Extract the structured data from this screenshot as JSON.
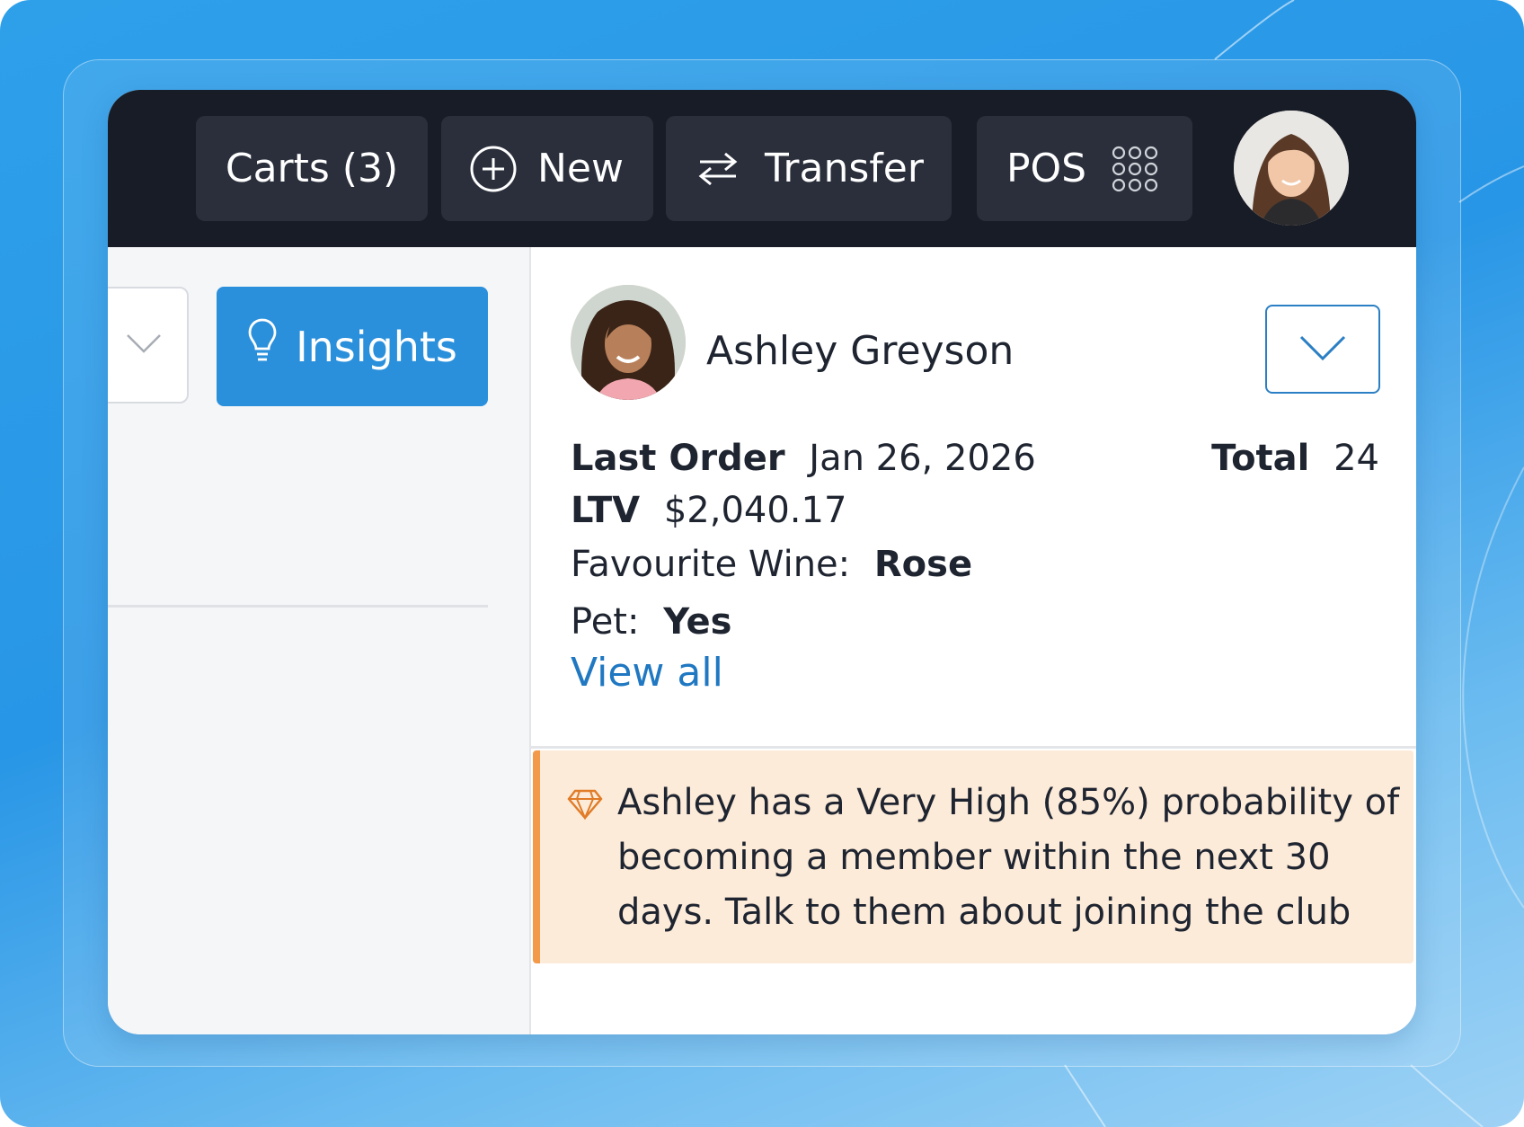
{
  "topbar": {
    "carts_label": "Carts (3)",
    "new_label": "New",
    "transfer_label": "Transfer",
    "pos_label": "POS",
    "icons": {
      "new": "plus-circle-icon",
      "transfer": "swap-arrows-icon",
      "pos": "grid-dots-icon"
    }
  },
  "left_panel": {
    "insights_label": "Insights",
    "insights_icon": "lightbulb-icon"
  },
  "customer": {
    "name": "Ashley Greyson",
    "last_order_label": "Last Order",
    "last_order_value": "Jan 26, 2026",
    "total_label": "Total",
    "total_value": "24",
    "ltv_label": "LTV",
    "ltv_value": "$2,040.17",
    "favourite_wine_label": "Favourite Wine:",
    "favourite_wine_value": "Rose",
    "pet_label": "Pet:",
    "pet_value": "Yes",
    "view_all_label": "View all"
  },
  "insight_alert": {
    "icon": "diamond-icon",
    "text": "Ashley has a Very High (85%) probability of becoming a member within the next 30 days. Talk to them about joining the club"
  },
  "colors": {
    "topbar_bg": "#181c26",
    "button_bg": "#2a2f3b",
    "accent_blue": "#2b90db",
    "link_blue": "#1f78c1",
    "alert_bg": "#fdebd9",
    "alert_border": "#f39a4a"
  }
}
